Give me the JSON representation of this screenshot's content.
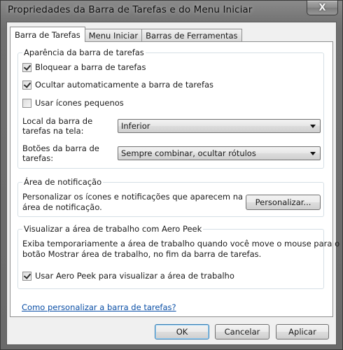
{
  "window": {
    "title": "Propriedades da Barra de Tarefas e do Menu Iniciar",
    "close_glyph": "X"
  },
  "tabs": [
    {
      "label": "Barra de Tarefas",
      "active": true
    },
    {
      "label": "Menu Iniciar",
      "active": false
    },
    {
      "label": "Barras de Ferramentas",
      "active": false
    }
  ],
  "appearance": {
    "label": "Aparência da barra de tarefas",
    "lock": {
      "label": "Bloquear a barra de tarefas",
      "checked": true
    },
    "autohide": {
      "label": "Ocultar automaticamente a barra de tarefas",
      "checked": true
    },
    "small_icons": {
      "label": "Usar ícones pequenos",
      "checked": false
    },
    "location": {
      "label": "Local da barra de\ntarefas na tela:",
      "value": "Inferior"
    },
    "buttons": {
      "label": "Botões da barra de\ntarefas:",
      "value": "Sempre combinar, ocultar rótulos"
    }
  },
  "notification": {
    "label": "Área de notificação",
    "description": "Personalizar os ícones e notificações que aparecem na\nárea de notificação.",
    "customize_button": "Personalizar..."
  },
  "aero_peek": {
    "label": "Visualizar a área de trabalho com Aero Peek",
    "description": "Exiba temporariamente a área de trabalho quando você move o mouse para o\nbotão Mostrar área de trabalho, no fim da barra de tarefas.",
    "use_peek": {
      "label": "Usar Aero Peek para visualizar a área de trabalho",
      "checked": true
    }
  },
  "help_link": "Como personalizar a barra de tarefas?",
  "footer": {
    "ok": "OK",
    "cancel": "Cancelar",
    "apply": "Aplicar"
  }
}
